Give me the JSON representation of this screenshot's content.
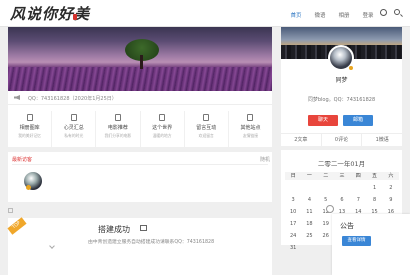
{
  "header": {
    "logo_text": "风说你好美",
    "nav": [
      "首页",
      "微语",
      "相册",
      "登录"
    ]
  },
  "main": {
    "notice": "QQ：743161828（2020年1月25日）",
    "features": [
      {
        "title": "相册图库",
        "sub": "我的美好记忆"
      },
      {
        "title": "心灵汇总",
        "sub": "私有的时光"
      },
      {
        "title": "电影推荐",
        "sub": "我们分享的电影"
      },
      {
        "title": "这个世界",
        "sub": "温暖的地方"
      },
      {
        "title": "留言互动",
        "sub": "欢迎留言"
      },
      {
        "title": "其他站点",
        "sub": "友情链接"
      }
    ]
  },
  "visitors": {
    "title": "最新访客",
    "more": "随机"
  },
  "post": {
    "ribbon": "TOP",
    "title": "搭建成功",
    "meta": "由中青创造建立服务自动搭建成功请联系QQ：743161828"
  },
  "profile": {
    "name": "同梦",
    "desc": "同梦blog。QQ：743161828",
    "chat_label": "聊天",
    "mail_label": "邮箱",
    "stats": [
      "2文章",
      "0评论",
      "1微语"
    ]
  },
  "calendar": {
    "title": "二零二一年01月",
    "weekdays": [
      "日",
      "一",
      "二",
      "三",
      "四",
      "五",
      "六"
    ],
    "days": [
      "",
      "",
      "",
      "",
      "",
      "1",
      "2",
      "3",
      "4",
      "5",
      "6",
      "7",
      "8",
      "9",
      "10",
      "11",
      "12",
      "13",
      "14",
      "15",
      "16",
      "17",
      "18",
      "19",
      "20",
      "21",
      "22",
      "23",
      "24",
      "25",
      "26",
      "27",
      "28",
      "29",
      "30",
      "31",
      "",
      "",
      "",
      "",
      "",
      ""
    ]
  },
  "announce": {
    "title": "公告",
    "button": "查看详情"
  },
  "colors": {
    "accent": "#3a86d6",
    "danger": "#e8453c",
    "badge": "#e9a520",
    "visitor_title": "#d33"
  }
}
